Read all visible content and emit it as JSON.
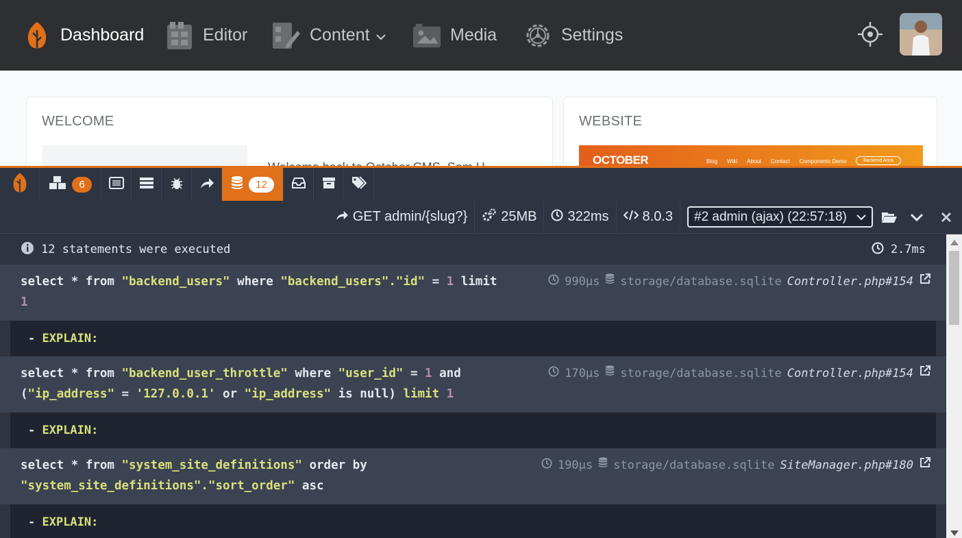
{
  "nav": {
    "items": [
      {
        "label": "Dashboard",
        "icon": "october-leaf-icon",
        "active": true
      },
      {
        "label": "Editor",
        "icon": "editor-icon"
      },
      {
        "label": "Content",
        "icon": "content-icon",
        "has_dropdown": true
      },
      {
        "label": "Media",
        "icon": "media-icon"
      },
      {
        "label": "Settings",
        "icon": "gear-icon"
      }
    ],
    "right_icons": [
      "crosshair-icon",
      "avatar"
    ]
  },
  "dashboard": {
    "welcome": {
      "title": "WELCOME",
      "text": "Welcome back to October CMS, Sam H"
    },
    "website": {
      "title": "WEBSITE",
      "preview": {
        "logo": "OCTOBER",
        "links": [
          "Blog",
          "Wiki",
          "About",
          "Contact",
          "Components Demo"
        ],
        "button": "Backend Area"
      }
    }
  },
  "debugbar": {
    "accent_color": "#e0701a",
    "tabs": [
      {
        "icon": "october-leaf-icon"
      },
      {
        "icon": "cubes-icon",
        "badge": "6"
      },
      {
        "icon": "list-icon"
      },
      {
        "icon": "tasks-icon"
      },
      {
        "icon": "bug-icon"
      },
      {
        "icon": "share-icon"
      },
      {
        "icon": "database-icon",
        "badge": "12",
        "active": true
      },
      {
        "icon": "inbox-icon"
      },
      {
        "icon": "archive-icon"
      },
      {
        "icon": "tags-icon"
      }
    ],
    "status": {
      "route": "GET admin/{slug?}",
      "memory": "25MB",
      "time": "322ms",
      "php_version": "8.0.3",
      "request_select": "#2 admin (ajax) (22:57:18)"
    },
    "summary": {
      "text": "12 statements were executed",
      "total_time": "2.7ms"
    },
    "queries": [
      {
        "sql_parts": [
          {
            "t": "select * from ",
            "c": "k"
          },
          {
            "t": "\"backend_users\"",
            "c": "s"
          },
          {
            "t": " where ",
            "c": "k"
          },
          {
            "t": "\"backend_users\".\"id\"",
            "c": "s"
          },
          {
            "t": " = ",
            "c": "k"
          },
          {
            "t": "1",
            "c": "n"
          },
          {
            "t": " limit ",
            "c": "k"
          },
          {
            "t": "1",
            "c": "n"
          }
        ],
        "duration": "990μs",
        "connection": "storage/database.sqlite",
        "source": "Controller.php#154"
      },
      {
        "sql_parts": [
          {
            "t": "select * from ",
            "c": "k"
          },
          {
            "t": "\"backend_user_throttle\"",
            "c": "s"
          },
          {
            "t": " where ",
            "c": "k"
          },
          {
            "t": "\"user_id\"",
            "c": "s"
          },
          {
            "t": " = ",
            "c": "k"
          },
          {
            "t": "1",
            "c": "n"
          },
          {
            "t": " and ",
            "c": "k"
          },
          {
            "t": "(",
            "c": "k"
          },
          {
            "t": "\"ip_address\"",
            "c": "s"
          },
          {
            "t": " = ",
            "c": "k"
          },
          {
            "t": "'127.0.0.1'",
            "c": "s"
          },
          {
            "t": " or ",
            "c": "k"
          },
          {
            "t": "\"ip_address\"",
            "c": "s"
          },
          {
            "t": " is null) ",
            "c": "k"
          },
          {
            "t": "limit ",
            "c": "s"
          },
          {
            "t": "1",
            "c": "n"
          }
        ],
        "duration": "170μs",
        "connection": "storage/database.sqlite",
        "source": "Controller.php#154"
      },
      {
        "sql_parts": [
          {
            "t": "select * from ",
            "c": "k"
          },
          {
            "t": "\"system_site_definitions\"",
            "c": "s"
          },
          {
            "t": " order by ",
            "c": "k"
          },
          {
            "t": "\"system_site_definitions\".\"sort_order\"",
            "c": "s"
          },
          {
            "t": " asc",
            "c": "k"
          }
        ],
        "duration": "190μs",
        "connection": "storage/database.sqlite",
        "source": "SiteManager.php#180"
      }
    ],
    "explain_label": "- ",
    "explain_text": "EXPLAIN:"
  }
}
